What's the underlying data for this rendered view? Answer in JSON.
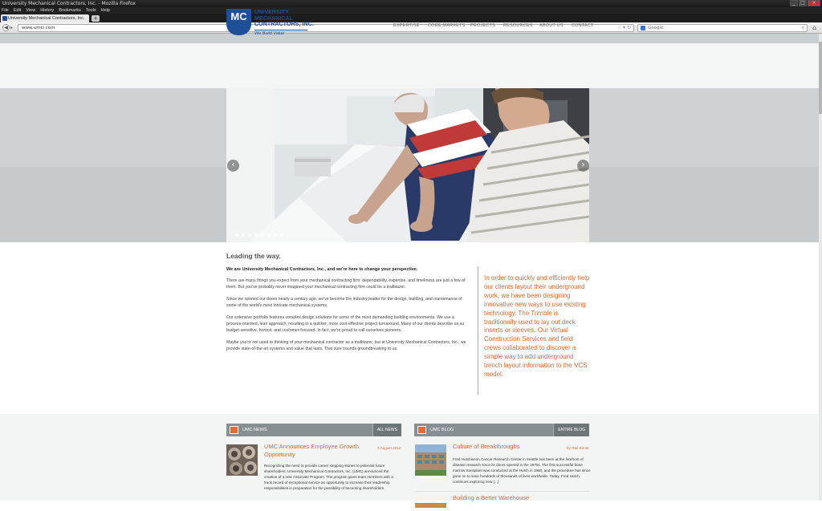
{
  "browser": {
    "window_title": "University Mechanical Contractors, Inc. - Mozilla Firefox",
    "menu": [
      "File",
      "Edit",
      "View",
      "History",
      "Bookmarks",
      "Tools",
      "Help"
    ],
    "tab_title": "University Mechanical Contractors, Inc.",
    "new_tab": "+",
    "url": "www.umci.com",
    "search_placeholder": "Google"
  },
  "header": {
    "logo_mark": "MC",
    "logo_lines": [
      "UNIVERSITY",
      "MECHANICAL",
      "CONTRACTORS, INC."
    ],
    "tagline": "We Build Value",
    "nav": [
      "EXPERTISE",
      "CORE MARKETS",
      "PROJECTS",
      "RESOURCES",
      "ABOUT US",
      "CONTACT"
    ]
  },
  "slider": {
    "prev": "‹",
    "next": "›",
    "slide_count": 8,
    "active_slide": 1
  },
  "content": {
    "heading": "Leading the way.",
    "lead": "We are University Mechanical Contractors, Inc., and we're here to change your perspective.",
    "paragraphs": [
      "There are many things you expect from your mechanical contracting firm: dependability, expertise, and timeliness are just a few of them. But you've probably never imagined your mechanical contracting firm could be a trailblazer.",
      "Since we opened our doors nearly a century ago, we've become the industry leader for the design, building, and maintenance of some of the world's most intricate mechanical systems.",
      "Our extensive portfolio features complex design solutions for some of the most demanding building environments. We use a process-oriented, lean approach, resulting in a quicker, more cost-effective project turnaround. Many of our clients describe us as budget-sensitive, honest, and customer-focused. In fact, we're proud to call ourselves pioneers.",
      "Maybe you're not used to thinking of your mechanical contractor as a trailblazer, but at University Mechanical Contractors, Inc., we provide state-of-the-art systems and value that lasts. That sure sounds groundbreaking to us."
    ],
    "quote": "In order to quickly and efficiently help our clients layout their underground work, we have been designing innovative new ways to use existing technology. The Trimble is traditionally used to lay out deck inserts or sleeves. Our Virtual Construction Services and field crews collaborated to discover a simple way to add underground trench layout information to the VCS model."
  },
  "news": {
    "title": "UMC NEWS",
    "button": "ALL NEWS",
    "item_title": "UMC Announces Employee Growth Opportunity",
    "item_date": "3 August 2012",
    "item_body": "Recognizing the need to provide career stepping stones to potential future shareholders, University Mechanical Contractors, Inc. (UMC) announced the creation of a new Associate Program. The program gives team members with a track record of exceptional service an opportunity to increase their leadership responsibilities in preparation for the possibility of becoming shareholders."
  },
  "blog": {
    "title": "UMC BLOG",
    "button": "ENTIRE BLOG",
    "item_title": "Culture of Breakthroughs",
    "item_author": "by Gail Kirner",
    "item_body": "Fred Hutchinson Cancer Research Center in Seattle has been at the forefront of disease research since its doors opened in the 1970s. The first successful bone marrow transplant was conducted at the Hutch in 1980, and the procedure has since gone on to save hundreds of thousands of lives worldwide. Today, Fred Hutch continues exploring new [...]",
    "next_item_title": "Building a Better Warehouse"
  },
  "colors": {
    "brand_blue": "#1f4f9b",
    "accent_orange": "#e2692d",
    "panel_gray": "#878f93"
  }
}
